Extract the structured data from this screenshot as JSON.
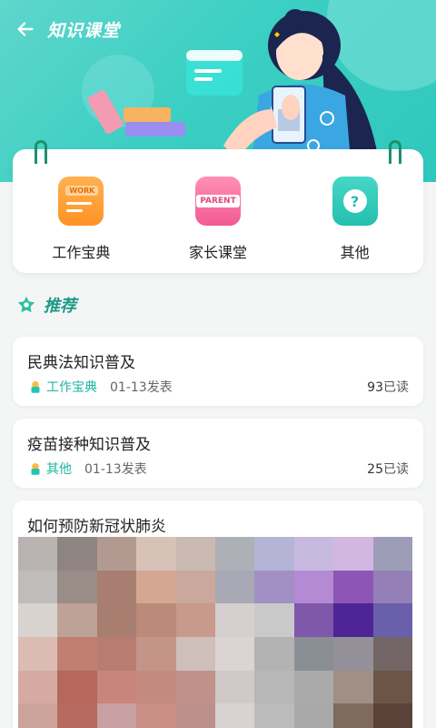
{
  "header": {
    "title": "知识课堂"
  },
  "categories": [
    {
      "label": "工作宝典",
      "badge": "WORK"
    },
    {
      "label": "家长课堂",
      "badge": "PARENT"
    },
    {
      "label": "其他",
      "badge": "?"
    }
  ],
  "section": {
    "title": "推荐"
  },
  "articles": [
    {
      "title": "民典法知识普及",
      "category": "工作宝典",
      "date": "01-13",
      "date_suffix": "发表",
      "reads": "93",
      "reads_suffix": "已读"
    },
    {
      "title": "疫苗接种知识普及",
      "category": "其他",
      "date": "01-13",
      "date_suffix": "发表",
      "reads": "25",
      "reads_suffix": "已读"
    },
    {
      "title": "如何预防新冠状肺炎"
    }
  ],
  "colors": {
    "accent": "#2fc8bd",
    "accent_text": "#1fb5a3",
    "work": "#ff9326",
    "parent": "#f25b93"
  }
}
